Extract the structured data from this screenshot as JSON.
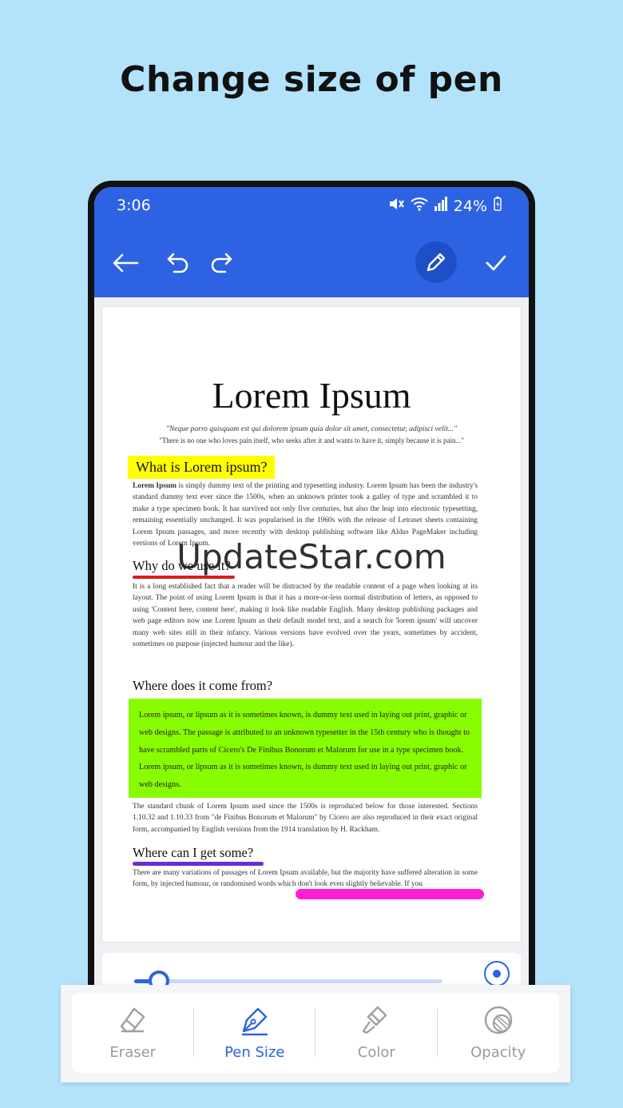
{
  "headline": "Change size of pen",
  "status": {
    "time": "3:06",
    "battery": "24%"
  },
  "toolbar": {
    "back_icon": "arrow-left-icon",
    "undo_icon": "undo-icon",
    "redo_icon": "redo-icon",
    "pen_icon": "pencil-icon",
    "confirm_icon": "check-icon"
  },
  "document": {
    "title": "Lorem Ipsum",
    "quote_latin": "\"Neque porro quisquam est qui dolorem ipsum quia dolor sit amet, consectetur, adipisci velit...\"",
    "quote_english": "\"There is no one who loves pain itself, who seeks after it and wants to have it, simply because it is pain...\"",
    "h1": "What is Lorem ipsum?",
    "p1_bold": "Lorem Ipsum",
    "p1_rest": " is simply dummy text of the printing and typesetting industry. Lorem Ipsum has been the industry's standard dummy text ever since the 1500s, when an unknown printer took a galley of type and scrambled it to make a type specimen book. It has survived not only five centuries, but also the leap into electronic typesetting, remaining essentially unchanged. It was popularised in the 1960s with the release of Letraset sheets containing Lorem Ipsum passages, and more recently with desktop publishing software like Aldus PageMaker including versions of Lorem Ipsum.",
    "h2": "Why do we use it?",
    "p2": "It is a long established fact that a reader will be distracted by the readable content of a page when looking at its layout. The point of using Lorem Ipsum is that it has a more-or-less normal distribution of letters, as opposed to using 'Content here, content here', making it look like readable English. Many desktop publishing packages and web page editors now use Lorem Ipsum as their default model text, and a search for 'lorem ipsum' will uncover many web sites still in their infancy. Various versions have evolved over the years, sometimes by accident, sometimes on purpose (injected humour and the like).",
    "h3": "Where does it come from?",
    "p3": "Lorem ipsum, or lipsum as it is sometimes known, is dummy text used in laying out print, graphic or web designs. The passage is attributed to an unknown typesetter in the 15th century who is thought to have scrambled parts of Cicero's De Finibus Bonorum et Malorum for use in a type specimen book. Lorem ipsum, or lipsum as it is sometimes known, is dummy text used in laying out print, graphic or web designs.",
    "p4": "The standard chunk of Lorem Ipsum used since the 1500s is reproduced below for those interested. Sections 1.10.32 and 1.10.33 from \"de Finibus Bonorum et Malorum\" by Cicero are also reproduced in their exact original form, accompanied by English versions from the 1914 translation by H. Rackham.",
    "h4": "Where can I get some?",
    "p5": "There are many variations of passages of Lorem Ipsum available, but the majority have suffered alteration in some form, by injected humour, or randomised words which don't look even slightly believable. If you"
  },
  "watermark": "UpdateStar.com",
  "pen_size": {
    "level_fraction": 0.08
  },
  "tools": [
    {
      "label": "Eraser",
      "icon": "eraser-icon",
      "active": false
    },
    {
      "label": "Pen Size",
      "icon": "pen-nib-icon",
      "active": true
    },
    {
      "label": "Color",
      "icon": "paint-brush-icon",
      "active": false
    },
    {
      "label": "Opacity",
      "icon": "opacity-icon",
      "active": false
    }
  ],
  "colors": {
    "primary": "#2d63e3",
    "background": "#b3e3fb",
    "highlight_yellow": "#ffff00",
    "highlight_green": "#88fc00",
    "line_red": "#e01b1b",
    "line_purple": "#6b2cd7",
    "line_pink": "#ff1ed2"
  }
}
